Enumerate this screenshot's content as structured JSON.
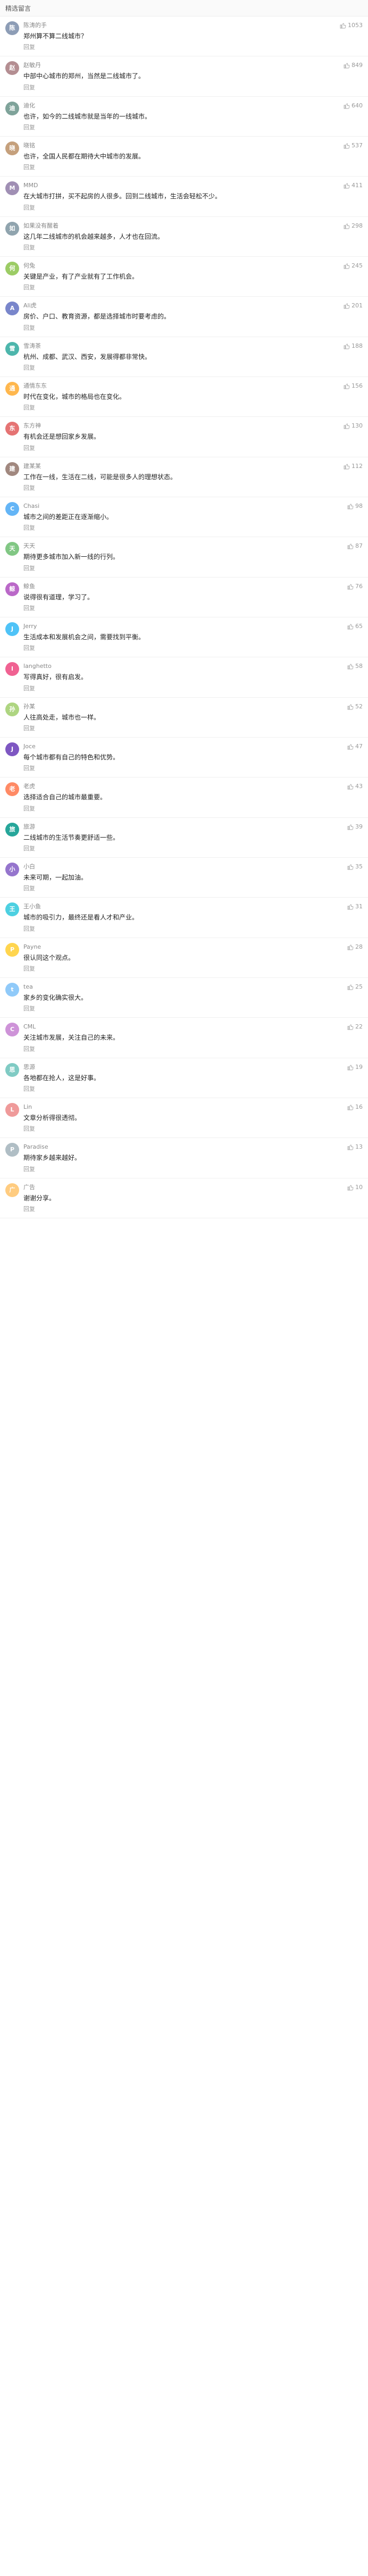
{
  "section_title": "精选留言",
  "reply_label": "回复",
  "comments": [
    {
      "user": "陈涛的手",
      "avatar": "陈",
      "color": "#8d9db6",
      "likes": "1053",
      "text": "郑州算不算二线城市？"
    },
    {
      "user": "赵敏丹",
      "avatar": "赵",
      "color": "#b48e92",
      "likes": "849",
      "text": "中部中心城市的郑州，当然是二线城市了。"
    },
    {
      "user": "迪化",
      "avatar": "迪",
      "color": "#7fa39a",
      "likes": "640",
      "text": "也许，如今的二线城市就是当年的一线城市。"
    },
    {
      "user": "晓铭",
      "avatar": "晓",
      "color": "#c5a07c",
      "likes": "537",
      "text": "也许，全国人民都在期待大中城市的发展。"
    },
    {
      "user": "MMD",
      "avatar": "M",
      "color": "#a08fb4",
      "likes": "411",
      "text": "在大城市打拼，买不起房的人很多。回到二线城市，生活会轻松不少。"
    },
    {
      "user": "如果没有醒着",
      "avatar": "如",
      "color": "#90a4ae",
      "likes": "298",
      "text": "这几年二线城市的机会越来越多，人才也在回流。"
    },
    {
      "user": "何兔",
      "avatar": "何",
      "color": "#9ccc65",
      "likes": "245",
      "text": "关键是产业，有了产业就有了工作机会。"
    },
    {
      "user": "Ali虎",
      "avatar": "A",
      "color": "#7986cb",
      "likes": "201",
      "text": "房价、户口、教育资源，都是选择城市时要考虑的。"
    },
    {
      "user": "雪涛茶",
      "avatar": "雪",
      "color": "#4db6ac",
      "likes": "188",
      "text": "杭州、成都、武汉、西安，发展得都非常快。"
    },
    {
      "user": "通情东东",
      "avatar": "通",
      "color": "#ffb74d",
      "likes": "156",
      "text": "时代在变化，城市的格局也在变化。"
    },
    {
      "user": "东方神",
      "avatar": "东",
      "color": "#e57373",
      "likes": "130",
      "text": "有机会还是想回家乡发展。"
    },
    {
      "user": "建某某",
      "avatar": "建",
      "color": "#a1887f",
      "likes": "112",
      "text": "工作在一线，生活在二线，可能是很多人的理想状态。"
    },
    {
      "user": "Chasi",
      "avatar": "C",
      "color": "#64b5f6",
      "likes": "98",
      "text": "城市之间的差距正在逐渐缩小。"
    },
    {
      "user": "天天",
      "avatar": "天",
      "color": "#81c784",
      "likes": "87",
      "text": "期待更多城市加入新一线的行列。"
    },
    {
      "user": "鲸鱼",
      "avatar": "鲸",
      "color": "#ba68c8",
      "likes": "76",
      "text": "说得很有道理，学习了。"
    },
    {
      "user": "Jerry",
      "avatar": "J",
      "color": "#4fc3f7",
      "likes": "65",
      "text": "生活成本和发展机会之间，需要找到平衡。"
    },
    {
      "user": "langhetto",
      "avatar": "l",
      "color": "#f06292",
      "likes": "58",
      "text": "写得真好，很有启发。"
    },
    {
      "user": "孙某",
      "avatar": "孙",
      "color": "#aed581",
      "likes": "52",
      "text": "人往高处走，城市也一样。"
    },
    {
      "user": "Joce",
      "avatar": "J",
      "color": "#7e57c2",
      "likes": "47",
      "text": "每个城市都有自己的特色和优势。"
    },
    {
      "user": "老虎",
      "avatar": "老",
      "color": "#ff8a65",
      "likes": "43",
      "text": "选择适合自己的城市最重要。"
    },
    {
      "user": "旅游",
      "avatar": "旅",
      "color": "#26a69a",
      "likes": "39",
      "text": "二线城市的生活节奏更舒适一些。"
    },
    {
      "user": "小白",
      "avatar": "小",
      "color": "#9575cd",
      "likes": "35",
      "text": "未来可期，一起加油。"
    },
    {
      "user": "王小鱼",
      "avatar": "王",
      "color": "#4dd0e1",
      "likes": "31",
      "text": "城市的吸引力，最终还是看人才和产业。"
    },
    {
      "user": "Payne",
      "avatar": "P",
      "color": "#ffd54f",
      "likes": "28",
      "text": "很认同这个观点。"
    },
    {
      "user": "tea",
      "avatar": "t",
      "color": "#90caf9",
      "likes": "25",
      "text": "家乡的变化确实很大。"
    },
    {
      "user": "CML",
      "avatar": "C",
      "color": "#ce93d8",
      "likes": "22",
      "text": "关注城市发展，关注自己的未来。"
    },
    {
      "user": "思源",
      "avatar": "思",
      "color": "#80cbc4",
      "likes": "19",
      "text": "各地都在抢人，这是好事。"
    },
    {
      "user": "Lin",
      "avatar": "L",
      "color": "#ef9a9a",
      "likes": "16",
      "text": "文章分析得很透彻。"
    },
    {
      "user": "Paradise",
      "avatar": "P",
      "color": "#b0bec5",
      "likes": "13",
      "text": "期待家乡越来越好。"
    },
    {
      "user": "广告",
      "avatar": "广",
      "color": "#ffcc80",
      "likes": "10",
      "text": "谢谢分享。"
    }
  ]
}
